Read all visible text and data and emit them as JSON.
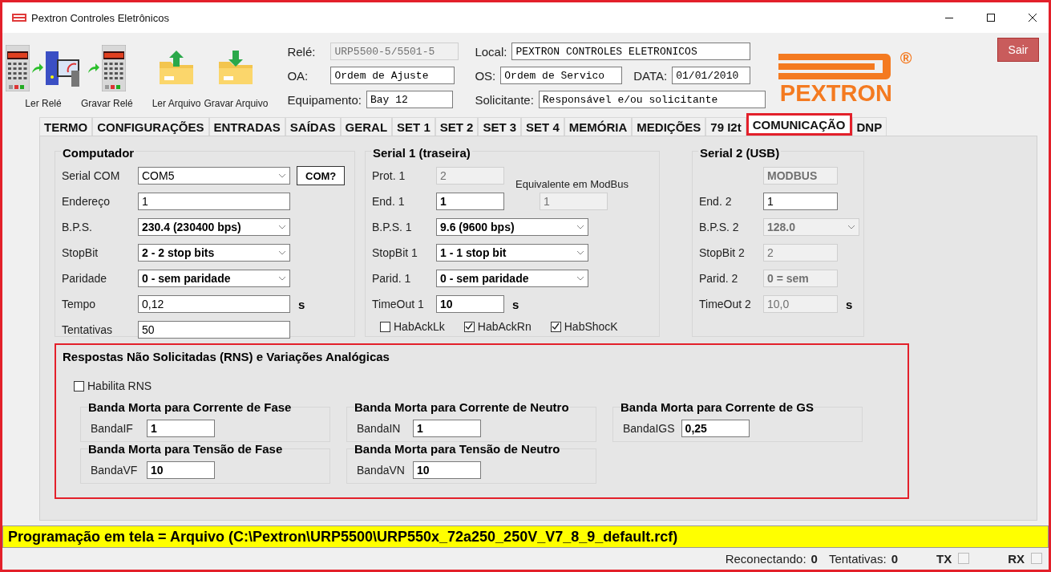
{
  "window": {
    "title": "Pextron Controles Eletrônicos"
  },
  "toolbar": [
    {
      "kind": "relay_read",
      "label": "Ler Relé"
    },
    {
      "kind": "relay_write",
      "label": "Gravar Relé"
    },
    {
      "kind": "file_open",
      "label": "Ler Arquivo"
    },
    {
      "kind": "file_save",
      "label": "Gravar Arquivo"
    }
  ],
  "header_columns": [
    [
      {
        "label": "Relé:",
        "value": "URP5500-5/5501-5",
        "disabled": true
      }
    ],
    [
      {
        "label": "OA:",
        "value": "Ordem de Ajuste",
        "disabled": false
      }
    ],
    [
      {
        "label": "Equipamento:",
        "value": "Bay 12",
        "disabled": false
      }
    ]
  ],
  "header_columns_2": [
    [
      {
        "label": "Local:",
        "value": "PEXTRON CONTROLES ELETRONICOS",
        "disabled": false
      }
    ],
    [
      {
        "label": "OS:",
        "value": "Ordem de Servico",
        "disabled": false
      },
      {
        "label": "DATA:",
        "value": "01/01/2010",
        "disabled": false
      }
    ],
    [
      {
        "label": "Solicitante:",
        "value": "Responsável e/ou solicitante",
        "disabled": false
      }
    ]
  ],
  "logo": {
    "text": "PEXTRON",
    "mark": "®"
  },
  "exit_button": "Sair",
  "tabs": [
    {
      "label": "TERMO",
      "selected": false
    },
    {
      "label": "CONFIGURAÇÕES",
      "selected": false
    },
    {
      "label": "ENTRADAS",
      "selected": false
    },
    {
      "label": "SAÍDAS",
      "selected": false
    },
    {
      "label": "GERAL",
      "selected": false
    },
    {
      "label": "SET 1",
      "selected": false
    },
    {
      "label": "SET 2",
      "selected": false
    },
    {
      "label": "SET 3",
      "selected": false
    },
    {
      "label": "SET 4",
      "selected": false
    },
    {
      "label": "MEMÓRIA",
      "selected": false
    },
    {
      "label": "MEDIÇÕES",
      "selected": false
    },
    {
      "label": "79 I2t",
      "selected": false
    },
    {
      "label": "COMUNICAÇÃO",
      "selected": true
    },
    {
      "label": "DNP",
      "selected": false
    }
  ],
  "groups": [
    {
      "title": "Computador",
      "rows": [
        {
          "label": "Serial COM",
          "kind": "select",
          "value": "COM5",
          "bold": false,
          "disabled": false,
          "button": "COM?"
        },
        {
          "label": "Endereço",
          "kind": "input",
          "value": "1",
          "bold": false,
          "disabled": false
        },
        {
          "label": "B.P.S.",
          "kind": "select",
          "value": "230.4 (230400 bps)",
          "bold": true,
          "disabled": false
        },
        {
          "label": "StopBit",
          "kind": "select",
          "value": "2 - 2 stop bits",
          "bold": true,
          "disabled": false
        },
        {
          "label": "Paridade",
          "kind": "select",
          "value": "0 - sem paridade",
          "bold": true,
          "disabled": false
        },
        {
          "label": "Tempo",
          "kind": "input",
          "value": "0,12",
          "bold": false,
          "disabled": false,
          "unit": "s"
        },
        {
          "label": "Tentativas",
          "kind": "input",
          "value": "50",
          "bold": false,
          "disabled": false
        }
      ]
    },
    {
      "title": "Serial 1 (traseira)",
      "rows": [
        {
          "label": "Prot.  1",
          "kind": "input",
          "value": "2",
          "bold": false,
          "disabled": true,
          "note": "Equivalente em ModBus"
        },
        {
          "label": "End. 1",
          "kind": "input",
          "value": "1",
          "bold": true,
          "disabled": false,
          "extra": {
            "value": "1",
            "disabled": true
          }
        },
        {
          "label": "B.P.S. 1",
          "kind": "select",
          "value": "9.6 (9600 bps)",
          "bold": true,
          "disabled": false
        },
        {
          "label": "StopBit 1",
          "kind": "select",
          "value": "1 - 1 stop bit",
          "bold": true,
          "disabled": false
        },
        {
          "label": "Parid. 1",
          "kind": "select",
          "value": "0 - sem paridade",
          "bold": true,
          "disabled": false
        },
        {
          "label": "TimeOut 1",
          "kind": "input",
          "value": "10",
          "bold": true,
          "disabled": false,
          "unit": "s"
        }
      ],
      "checkboxes": [
        {
          "label": "HabAckLk",
          "checked": false
        },
        {
          "label": "HabAckRn",
          "checked": true
        },
        {
          "label": "HabShocK",
          "checked": true
        }
      ]
    },
    {
      "title": "Serial 2 (USB)",
      "rows": [
        {
          "kind": "input",
          "value": "MODBUS",
          "bold": true,
          "disabled": true
        },
        {
          "label": "End. 2",
          "kind": "input",
          "value": "1",
          "bold": false,
          "disabled": false
        },
        {
          "label": "B.P.S. 2",
          "kind": "select",
          "value": "128.0",
          "bold": true,
          "disabled": true
        },
        {
          "label": "StopBit 2",
          "kind": "input",
          "value": "2",
          "bold": false,
          "disabled": true
        },
        {
          "label": "Parid. 2",
          "kind": "input",
          "value": "0 = sem",
          "bold": true,
          "disabled": true
        },
        {
          "label": "TimeOut 2",
          "kind": "input",
          "value": "10,0",
          "bold": false,
          "disabled": true,
          "unit": "s"
        }
      ]
    }
  ],
  "rns": {
    "title": "Respostas Não Solicitadas (RNS) e Variações Analógicas",
    "highlighted": true,
    "enable": {
      "label": "Habilita  RNS",
      "checked": false
    },
    "bands": [
      [
        {
          "title": "Banda Morta para Corrente de Fase",
          "label": "BandaIF",
          "value": "1"
        },
        {
          "title": "Banda Morta para Corrente de Neutro",
          "label": "BandaIN",
          "value": "1"
        },
        {
          "title": "Banda Morta para Corrente de GS",
          "label": "BandaIGS",
          "value": "0,25"
        }
      ],
      [
        {
          "title": "Banda Morta para Tensão de Fase",
          "label": "BandaVF",
          "value": "10"
        },
        {
          "title": "Banda Morta para Tensão de Neutro",
          "label": "BandaVN",
          "value": "10"
        }
      ]
    ]
  },
  "message": "Programação em tela = Arquivo (C:\\Pextron\\URP5500\\URP550x_72a250_250V_V7_8_9_default.rcf)",
  "status_bar": {
    "counters": [
      {
        "label": "Reconectando:",
        "value": "0"
      },
      {
        "label": "Tentativas:",
        "value": "0"
      }
    ],
    "indicators": [
      {
        "label": "TX",
        "on": false
      },
      {
        "label": "RX",
        "on": false
      }
    ]
  }
}
